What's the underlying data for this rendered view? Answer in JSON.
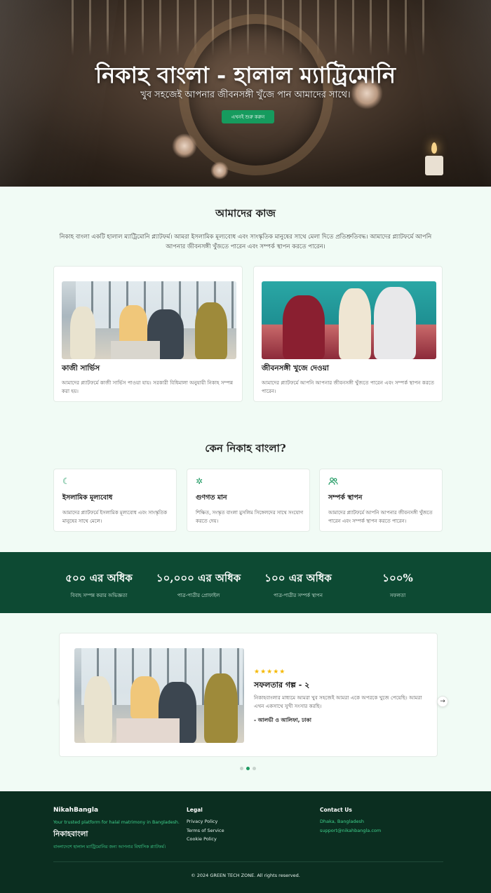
{
  "hero": {
    "title": "নিকাহ বাংলা - হালাল ম্যাট্রিমোনি",
    "subtitle": "খুব সহজেই আপনার জীবনসঙ্গী খুঁজে পান আমাদের সাথে।",
    "cta": "এখনই শুরু করুন"
  },
  "work": {
    "title": "আমাদের কাজ",
    "intro": "নিকাহ বাংলা একটি হালাল ম্যাট্রিমোনি প্ল্যাটফর্ম। আমরা ইসলামিক মূল্যবোধ এবং সাংস্কৃতিক মানুষের সাথে মেলা দিতে প্রতিশ্রুতিবদ্ধ। আমাদের প্ল্যাটফর্মে আপনি আপনার জীবনসঙ্গী খুঁজতে পারেন এবং সম্পর্ক স্থাপন করতে পারেন।",
    "cards": [
      {
        "title": "কাজী সার্ভিস",
        "text": "আমাদের প্ল্যাটফর্মে কাজী সার্ভিস পাওয়া যায়। সরকারী বিধিমালা অনুযায়ী নিকাহ সম্পন্ন করা হয়।"
      },
      {
        "title": "জীবনসঙ্গী খুজে দেওয়া",
        "text": "আমাদের প্ল্যাটফর্মে আপনি আপনার জীবনসঙ্গী খুঁজতে পারেন এবং সম্পর্ক স্থাপন করতে পারেন।"
      }
    ]
  },
  "why": {
    "title": "কেন নিকাহ বাংলা?",
    "features": [
      {
        "icon": "moon-icon",
        "title": "ইসলামিক মূল্যবোধ",
        "text": "আমাদের প্ল্যাটফর্মে ইসলামিক মূল্যবোধ এবং সাংস্কৃতিক মানুষের সাথে মেলে।"
      },
      {
        "icon": "sparkles-icon",
        "title": "গুণগত মান",
        "text": "শিক্ষিত, সংস্কৃত বাংলা মুসলিম সিঙ্গেলদের সাথে সংযোগ করতে দেয়।"
      },
      {
        "icon": "users-icon",
        "title": "সম্পর্ক স্থাপন",
        "text": "আমাদের প্ল্যাটফর্মে আপনি আপনার জীবনসঙ্গী খুঁজতে পারেন এবং সম্পর্ক স্থাপন করতে পারেন।"
      }
    ]
  },
  "stats": [
    {
      "value": "৫০০ এর অধিক",
      "label": "বিবাহ সম্পন্ন করার অভিজ্ঞতা"
    },
    {
      "value": "১০,০০০ এর অধিক",
      "label": "পাত্র-পাত্রীর প্রোফাইল"
    },
    {
      "value": "১০০ এর অধিক",
      "label": "পাত্র-পাত্রীর সম্পর্ক স্থাপন"
    },
    {
      "value": "১০০%",
      "label": "সফলতা"
    }
  ],
  "testimonial": {
    "stars": "★★★★★",
    "rating": 5,
    "title": "সফলতার গল্প - ২",
    "text": "নিকাহবাংলার মাধ্যমে আমরা খুব সহজেই আমরা একে অপরকে খুজে পেয়েছি। আমরা এখন একসাথে সুখী সংসার করছি।",
    "author": "- আলভী ও আলিফা, ঢাকা",
    "prev": "←",
    "next": "→",
    "active_slide": 2,
    "slide_count": 3
  },
  "footer": {
    "brand": "NikahBangla",
    "tagline": "Your trusted platform for halal matrimony in Bangladesh.",
    "brand_bn": "নিকাহবাংলা",
    "tagline_bn": "বাংলাদেশে হালাল ম্যাট্রিমোনির জন্য আপনার বিশ্বাসিক প্ল্যাটফর্ম।",
    "legal_title": "Legal",
    "legal_links": [
      "Privacy Policy",
      "Terms of Service",
      "Cookie Policy"
    ],
    "contact_title": "Contact Us",
    "contact_location": "Dhaka, Bangladesh",
    "contact_email": "support@nikahbangla.com",
    "copyright": "© 2024 GREEN TECH ZONE. All rights reserved."
  },
  "colors": {
    "accent": "#1e9a62",
    "stats_bg": "#0d4a33",
    "footer_bg": "#0b2e20",
    "stars": "#f5b800"
  }
}
